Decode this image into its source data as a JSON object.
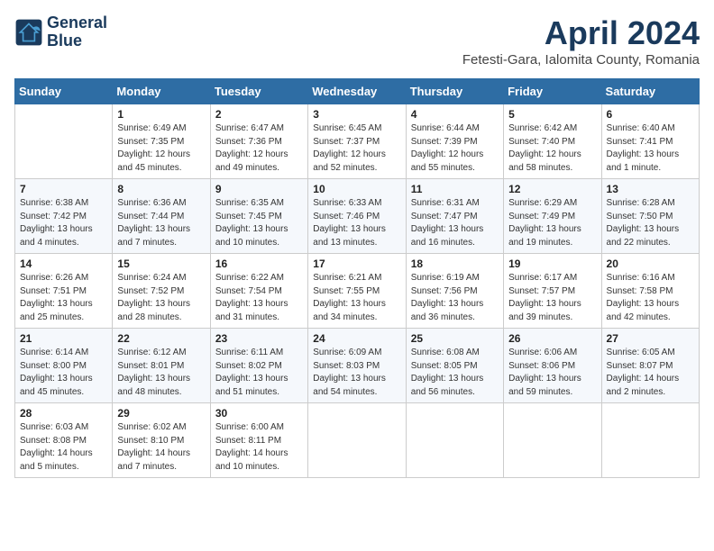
{
  "logo": {
    "line1": "General",
    "line2": "Blue"
  },
  "title": "April 2024",
  "location": "Fetesti-Gara, Ialomita County, Romania",
  "weekdays": [
    "Sunday",
    "Monday",
    "Tuesday",
    "Wednesday",
    "Thursday",
    "Friday",
    "Saturday"
  ],
  "weeks": [
    [
      {
        "day": "",
        "sunrise": "",
        "sunset": "",
        "daylight": ""
      },
      {
        "day": "1",
        "sunrise": "Sunrise: 6:49 AM",
        "sunset": "Sunset: 7:35 PM",
        "daylight": "Daylight: 12 hours and 45 minutes."
      },
      {
        "day": "2",
        "sunrise": "Sunrise: 6:47 AM",
        "sunset": "Sunset: 7:36 PM",
        "daylight": "Daylight: 12 hours and 49 minutes."
      },
      {
        "day": "3",
        "sunrise": "Sunrise: 6:45 AM",
        "sunset": "Sunset: 7:37 PM",
        "daylight": "Daylight: 12 hours and 52 minutes."
      },
      {
        "day": "4",
        "sunrise": "Sunrise: 6:44 AM",
        "sunset": "Sunset: 7:39 PM",
        "daylight": "Daylight: 12 hours and 55 minutes."
      },
      {
        "day": "5",
        "sunrise": "Sunrise: 6:42 AM",
        "sunset": "Sunset: 7:40 PM",
        "daylight": "Daylight: 12 hours and 58 minutes."
      },
      {
        "day": "6",
        "sunrise": "Sunrise: 6:40 AM",
        "sunset": "Sunset: 7:41 PM",
        "daylight": "Daylight: 13 hours and 1 minute."
      }
    ],
    [
      {
        "day": "7",
        "sunrise": "Sunrise: 6:38 AM",
        "sunset": "Sunset: 7:42 PM",
        "daylight": "Daylight: 13 hours and 4 minutes."
      },
      {
        "day": "8",
        "sunrise": "Sunrise: 6:36 AM",
        "sunset": "Sunset: 7:44 PM",
        "daylight": "Daylight: 13 hours and 7 minutes."
      },
      {
        "day": "9",
        "sunrise": "Sunrise: 6:35 AM",
        "sunset": "Sunset: 7:45 PM",
        "daylight": "Daylight: 13 hours and 10 minutes."
      },
      {
        "day": "10",
        "sunrise": "Sunrise: 6:33 AM",
        "sunset": "Sunset: 7:46 PM",
        "daylight": "Daylight: 13 hours and 13 minutes."
      },
      {
        "day": "11",
        "sunrise": "Sunrise: 6:31 AM",
        "sunset": "Sunset: 7:47 PM",
        "daylight": "Daylight: 13 hours and 16 minutes."
      },
      {
        "day": "12",
        "sunrise": "Sunrise: 6:29 AM",
        "sunset": "Sunset: 7:49 PM",
        "daylight": "Daylight: 13 hours and 19 minutes."
      },
      {
        "day": "13",
        "sunrise": "Sunrise: 6:28 AM",
        "sunset": "Sunset: 7:50 PM",
        "daylight": "Daylight: 13 hours and 22 minutes."
      }
    ],
    [
      {
        "day": "14",
        "sunrise": "Sunrise: 6:26 AM",
        "sunset": "Sunset: 7:51 PM",
        "daylight": "Daylight: 13 hours and 25 minutes."
      },
      {
        "day": "15",
        "sunrise": "Sunrise: 6:24 AM",
        "sunset": "Sunset: 7:52 PM",
        "daylight": "Daylight: 13 hours and 28 minutes."
      },
      {
        "day": "16",
        "sunrise": "Sunrise: 6:22 AM",
        "sunset": "Sunset: 7:54 PM",
        "daylight": "Daylight: 13 hours and 31 minutes."
      },
      {
        "day": "17",
        "sunrise": "Sunrise: 6:21 AM",
        "sunset": "Sunset: 7:55 PM",
        "daylight": "Daylight: 13 hours and 34 minutes."
      },
      {
        "day": "18",
        "sunrise": "Sunrise: 6:19 AM",
        "sunset": "Sunset: 7:56 PM",
        "daylight": "Daylight: 13 hours and 36 minutes."
      },
      {
        "day": "19",
        "sunrise": "Sunrise: 6:17 AM",
        "sunset": "Sunset: 7:57 PM",
        "daylight": "Daylight: 13 hours and 39 minutes."
      },
      {
        "day": "20",
        "sunrise": "Sunrise: 6:16 AM",
        "sunset": "Sunset: 7:58 PM",
        "daylight": "Daylight: 13 hours and 42 minutes."
      }
    ],
    [
      {
        "day": "21",
        "sunrise": "Sunrise: 6:14 AM",
        "sunset": "Sunset: 8:00 PM",
        "daylight": "Daylight: 13 hours and 45 minutes."
      },
      {
        "day": "22",
        "sunrise": "Sunrise: 6:12 AM",
        "sunset": "Sunset: 8:01 PM",
        "daylight": "Daylight: 13 hours and 48 minutes."
      },
      {
        "day": "23",
        "sunrise": "Sunrise: 6:11 AM",
        "sunset": "Sunset: 8:02 PM",
        "daylight": "Daylight: 13 hours and 51 minutes."
      },
      {
        "day": "24",
        "sunrise": "Sunrise: 6:09 AM",
        "sunset": "Sunset: 8:03 PM",
        "daylight": "Daylight: 13 hours and 54 minutes."
      },
      {
        "day": "25",
        "sunrise": "Sunrise: 6:08 AM",
        "sunset": "Sunset: 8:05 PM",
        "daylight": "Daylight: 13 hours and 56 minutes."
      },
      {
        "day": "26",
        "sunrise": "Sunrise: 6:06 AM",
        "sunset": "Sunset: 8:06 PM",
        "daylight": "Daylight: 13 hours and 59 minutes."
      },
      {
        "day": "27",
        "sunrise": "Sunrise: 6:05 AM",
        "sunset": "Sunset: 8:07 PM",
        "daylight": "Daylight: 14 hours and 2 minutes."
      }
    ],
    [
      {
        "day": "28",
        "sunrise": "Sunrise: 6:03 AM",
        "sunset": "Sunset: 8:08 PM",
        "daylight": "Daylight: 14 hours and 5 minutes."
      },
      {
        "day": "29",
        "sunrise": "Sunrise: 6:02 AM",
        "sunset": "Sunset: 8:10 PM",
        "daylight": "Daylight: 14 hours and 7 minutes."
      },
      {
        "day": "30",
        "sunrise": "Sunrise: 6:00 AM",
        "sunset": "Sunset: 8:11 PM",
        "daylight": "Daylight: 14 hours and 10 minutes."
      },
      {
        "day": "",
        "sunrise": "",
        "sunset": "",
        "daylight": ""
      },
      {
        "day": "",
        "sunrise": "",
        "sunset": "",
        "daylight": ""
      },
      {
        "day": "",
        "sunrise": "",
        "sunset": "",
        "daylight": ""
      },
      {
        "day": "",
        "sunrise": "",
        "sunset": "",
        "daylight": ""
      }
    ]
  ]
}
